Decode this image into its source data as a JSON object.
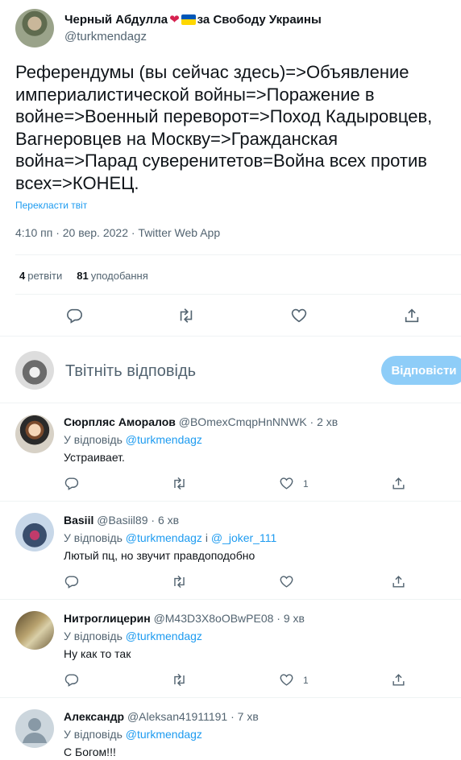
{
  "tweet": {
    "author_name": "Черный Абдулла",
    "author_name_suffix": "за Свободу Украины",
    "author_handle": "@turkmendagz",
    "text": "Референдумы (вы сейчас здесь)=>Объявление империалистической войны=>Поражение в войне=>Военный переворот=>Поход Кадыровцев, Вагнеровцев на Москву=>Гражданская война=>Парад суверенитетов=Война всех против всех=>КОНЕЦ.",
    "translate_label": "Перекласти твіт",
    "meta": "4:10 пп · 20 вер. 2022 · Twitter Web App",
    "retweets_count": "4",
    "retweets_label": "ретвіти",
    "likes_count": "81",
    "likes_label": "уподобання"
  },
  "composer": {
    "placeholder": "Твітніть відповідь",
    "reply_button": "Відповісти"
  },
  "colors": {
    "accent": "#1d9bf0",
    "reply_button_disabled": "#8ecdf8",
    "heart": "#d6214f"
  },
  "replies": [
    {
      "name": "Сюрпляс Аморалов",
      "handle": "@BOmexCmqpHnNNWK",
      "time": "· 2 хв",
      "replying_prefix": "У відповідь",
      "replying_to": "@turkmendagz",
      "replying_extra": "",
      "text": "Устраивает.",
      "likes": "1"
    },
    {
      "name": "Basiil",
      "handle": "@Basiil89",
      "time": "· 6 хв",
      "replying_prefix": "У відповідь",
      "replying_to": "@turkmendagz",
      "replying_and": "і",
      "replying_extra": "@_joker_111",
      "text": "Лютый пц, но звучит правдоподобно",
      "likes": ""
    },
    {
      "name": "Нитроглицерин",
      "handle": "@M43D3X8oOBwPE08",
      "time": "· 9 хв",
      "replying_prefix": "У відповідь",
      "replying_to": "@turkmendagz",
      "replying_extra": "",
      "text": "Ну как то так",
      "likes": "1"
    },
    {
      "name": "Александр",
      "handle": "@Aleksan41911191",
      "time": "· 7 хв",
      "replying_prefix": "У відповідь",
      "replying_to": "@turkmendagz",
      "replying_extra": "",
      "text": "С Богом!!!",
      "likes": ""
    }
  ]
}
